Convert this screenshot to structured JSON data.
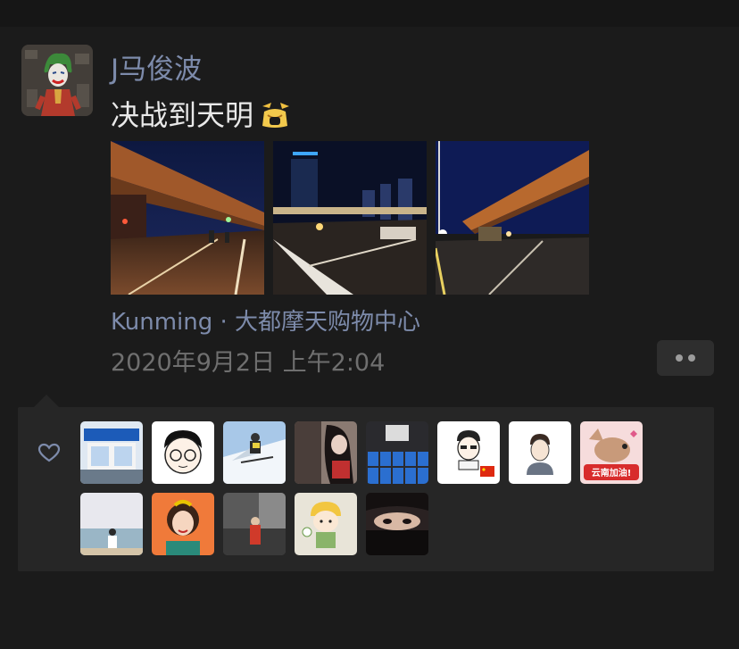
{
  "post": {
    "username": "J马俊波",
    "content": "决战到天明",
    "location": "Kunming · 大都摩天购物中心",
    "timestamp": "2020年9月2日 上午2:04",
    "photos": [
      {
        "name": "overpass-night-photo"
      },
      {
        "name": "city-night-road-photo"
      },
      {
        "name": "bridge-night-photo"
      }
    ]
  },
  "likes": {
    "badge_text": "云南加油!",
    "likers": [
      {
        "name": "liker-exhibition-booth"
      },
      {
        "name": "liker-cartoon-boy-glasses"
      },
      {
        "name": "liker-skier"
      },
      {
        "name": "liker-anime-girl"
      },
      {
        "name": "liker-blue-barrels"
      },
      {
        "name": "liker-cartoon-flag"
      },
      {
        "name": "liker-cartoon-man"
      },
      {
        "name": "liker-mouse-cartoon"
      },
      {
        "name": "liker-beach-photo"
      },
      {
        "name": "liker-girl-red"
      },
      {
        "name": "liker-street-photo"
      },
      {
        "name": "liker-cartoon-girl-hat"
      },
      {
        "name": "liker-eyes-photo"
      }
    ]
  }
}
